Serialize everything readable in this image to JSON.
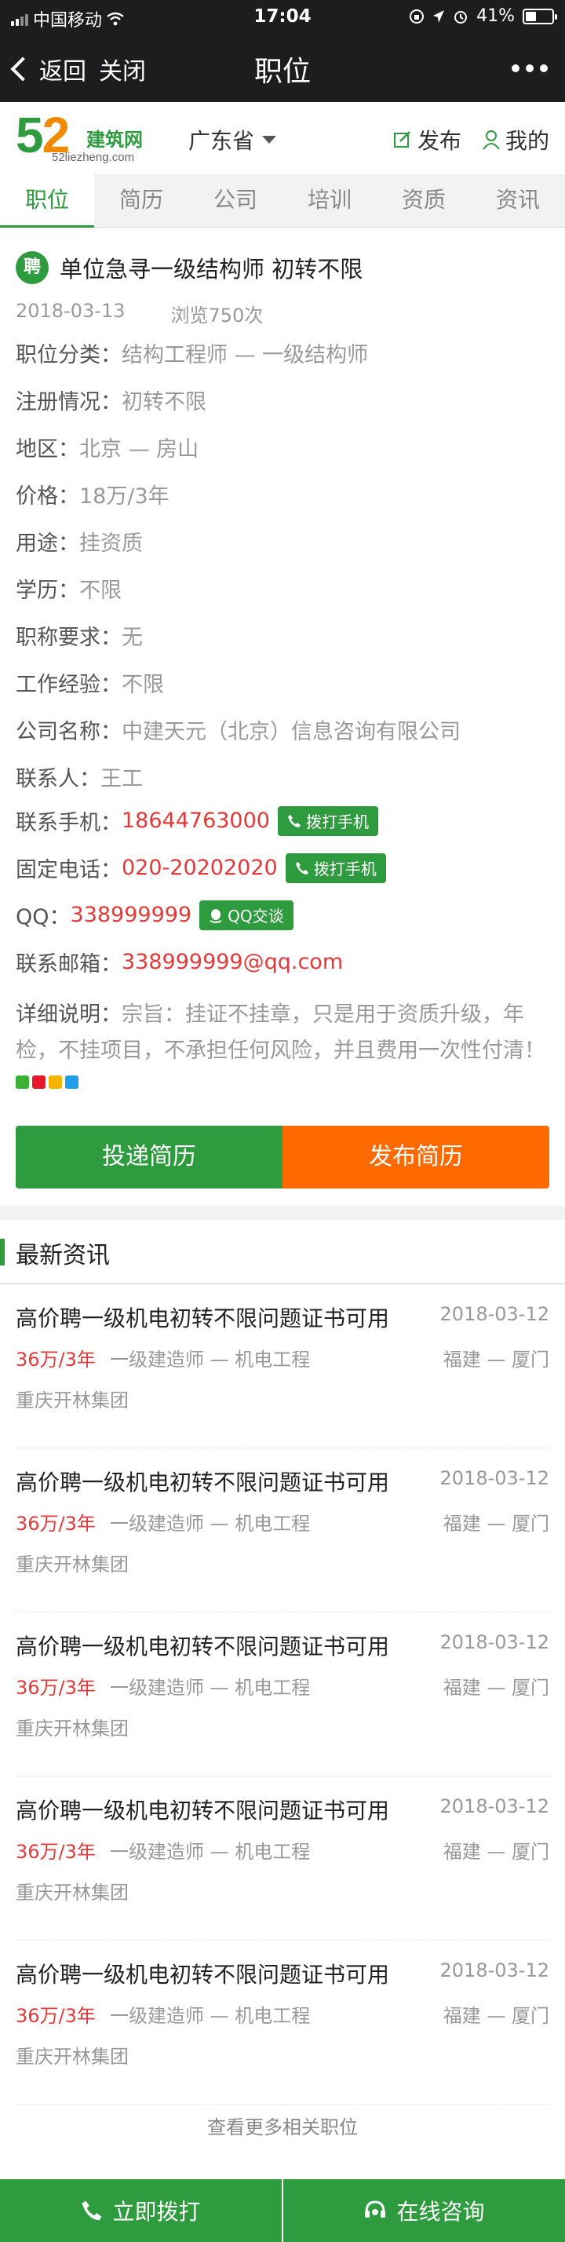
{
  "status_bar": {
    "carrier": "中国移动",
    "time": "17:04",
    "battery_text": "41%",
    "battery_level": 0.41
  },
  "nav": {
    "back_label": "返回",
    "close_label": "关闭",
    "title": "职位"
  },
  "header": {
    "logo_digit_1": "5",
    "logo_digit_2": "2",
    "logo_cn": "建筑网",
    "logo_domain": "52liezheng.com",
    "province": "广东省",
    "publish_label": "发布",
    "mine_label": "我的"
  },
  "tabs": [
    "职位",
    "简历",
    "公司",
    "培训",
    "资质",
    "资讯"
  ],
  "job": {
    "badge": "聘",
    "title": "单位急寻一级结构师 初转不限",
    "date": "2018-03-13",
    "views": "浏览750次",
    "fields": {
      "category_label": "职位分类：",
      "category": "结构工程师 — 一级结构师",
      "registration_label": "注册情况：",
      "registration": "初转不限",
      "region_label": "地区：",
      "region": "北京 — 房山",
      "price_label": "价格：",
      "price": "18万/3年",
      "usage_label": "用途：",
      "usage": "挂资质",
      "education_label": "学历：",
      "education": "不限",
      "title_req_label": "职称要求：",
      "title_req": "无",
      "experience_label": "工作经验：",
      "experience": "不限",
      "company_label": "公司名称：",
      "company": "中建天元（北京）信息咨询有限公司",
      "contact_label": "联系人：",
      "contact": "王工",
      "mobile_label": "联系手机：",
      "mobile": "18644763000",
      "phone_label": "固定电话：",
      "phone": "020-20202020",
      "qq_label": "QQ：",
      "qq": "338999999",
      "email_label": "联系邮箱：",
      "email": "338999999@qq.com",
      "desc_label": "详细说明：",
      "desc": "宗旨：挂证不挂章，只是用于资质升级，年检，不挂项目，不承担任何风险，并且费用一次性付清！"
    },
    "call_mobile_label": "拨打手机",
    "call_phone_label": "拨打手机",
    "qq_chat_label": "QQ交谈"
  },
  "actions": {
    "submit_resume": "投递简历",
    "post_resume": "发布简历"
  },
  "news": {
    "heading": "最新资讯",
    "items": [
      {
        "title": "高价聘一级机电初转不限问题证书可用",
        "date": "2018-03-12",
        "price": "36万/3年",
        "category": "一级建造师 — 机电工程",
        "location": "福建 — 厦门",
        "company": "重庆开林集团"
      },
      {
        "title": "高价聘一级机电初转不限问题证书可用",
        "date": "2018-03-12",
        "price": "36万/3年",
        "category": "一级建造师 — 机电工程",
        "location": "福建 — 厦门",
        "company": "重庆开林集团"
      },
      {
        "title": "高价聘一级机电初转不限问题证书可用",
        "date": "2018-03-12",
        "price": "36万/3年",
        "category": "一级建造师 — 机电工程",
        "location": "福建 — 厦门",
        "company": "重庆开林集团"
      },
      {
        "title": "高价聘一级机电初转不限问题证书可用",
        "date": "2018-03-12",
        "price": "36万/3年",
        "category": "一级建造师 — 机电工程",
        "location": "福建 — 厦门",
        "company": "重庆开林集团"
      },
      {
        "title": "高价聘一级机电初转不限问题证书可用",
        "date": "2018-03-12",
        "price": "36万/3年",
        "category": "一级建造师 — 机电工程",
        "location": "福建 — 厦门",
        "company": "重庆开林集团"
      }
    ],
    "more_label": "查看更多相关职位"
  },
  "bottom_bar": {
    "call_label": "立即拨打",
    "consult_label": "在线咨询"
  },
  "colors": {
    "brand_green": "#2e9b3f",
    "accent_orange": "#ff6a00",
    "price_red": "#e23a3a"
  }
}
